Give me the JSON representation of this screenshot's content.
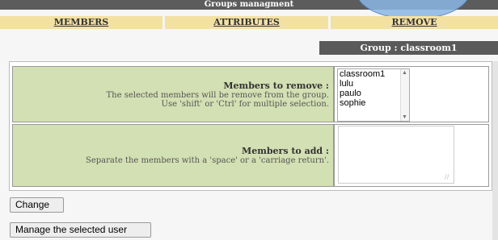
{
  "header": {
    "title": "Groups managment"
  },
  "tabs": [
    {
      "label": "MEMBERS"
    },
    {
      "label": "ATTRIBUTES"
    },
    {
      "label": "REMOVE"
    }
  ],
  "group": {
    "label": "Group : classroom1"
  },
  "remove_section": {
    "heading": "Members to remove :",
    "line1": "The selected members will be remove from the group.",
    "line2": "Use 'shift' or 'Ctrl' for multiple selection.",
    "members": [
      "classroom1",
      "lulu",
      "paulo",
      "sophie"
    ]
  },
  "add_section": {
    "heading": "Members to add :",
    "line1": "Separate the members with a 'space' or a 'carriage return'.",
    "value": ""
  },
  "buttons": {
    "change_label": "Change",
    "manage_label": "Manage the selected user"
  },
  "colors": {
    "title_bar": "#5c5c5c",
    "tab_bg": "#f3e1a2",
    "label_cell_bg": "#d3e0b3",
    "group_label_bg": "#5a5a5a"
  }
}
